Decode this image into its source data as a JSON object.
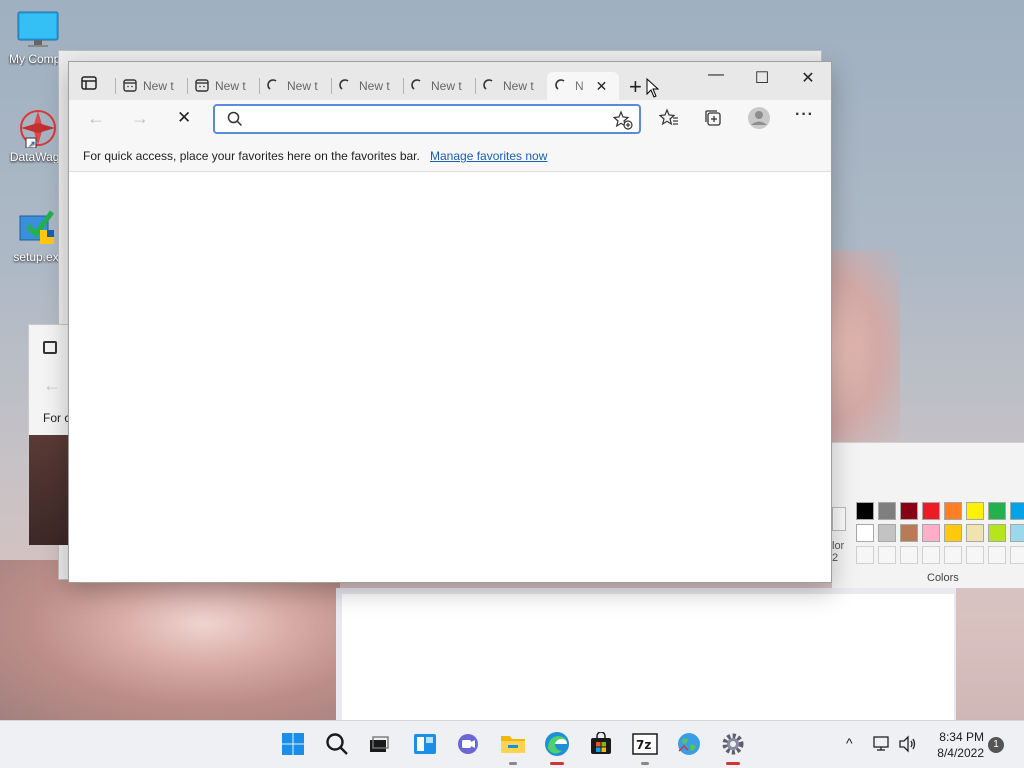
{
  "desktop": {
    "icons": [
      {
        "label": "My Compu"
      },
      {
        "label": "DataWago"
      },
      {
        "label": "setup.ex"
      }
    ]
  },
  "background_window": {
    "left_fragment": "For c"
  },
  "paint": {
    "colors_label": "Colors",
    "color_fragment_1": "lor",
    "color_fragment_2": "2",
    "palette_row1": [
      "#000000",
      "#7f7f7f",
      "#880015",
      "#ed1c24",
      "#ff7f27",
      "#fff200",
      "#22b14c",
      "#00a2e8"
    ],
    "palette_row2": [
      "#ffffff",
      "#c3c3c3",
      "#b97a57",
      "#ffaec9",
      "#ffc90e",
      "#efe4b0",
      "#b5e61d",
      "#99d9ea"
    ]
  },
  "browser": {
    "tabs": [
      {
        "label": "New t",
        "icon": "calendar-icon"
      },
      {
        "label": "New t",
        "icon": "calendar-icon"
      },
      {
        "label": "New t",
        "icon": "loading-icon"
      },
      {
        "label": "New t",
        "icon": "loading-icon"
      },
      {
        "label": "New t",
        "icon": "loading-icon"
      },
      {
        "label": "New t",
        "icon": "loading-icon"
      }
    ],
    "active_tab": {
      "label": "N",
      "close": "✕"
    },
    "newtab_glyph": "+",
    "window_controls": {
      "minimize": "—",
      "maximize": "☐",
      "close": "✕"
    },
    "nav": {
      "back": "←",
      "forward": "→",
      "stop": "✕"
    },
    "address": {
      "value": "",
      "placeholder": ""
    },
    "favorites_bar": {
      "message": "For quick access, place your favorites here on the favorites bar.",
      "link": "Manage favorites now"
    },
    "more_glyph": "···"
  },
  "taskbar": {
    "apps": [
      "start",
      "search",
      "task-view",
      "widgets",
      "chat",
      "file-explorer",
      "edge",
      "store",
      "7zip",
      "network-globe",
      "settings"
    ],
    "clock_time": "8:34 PM",
    "clock_date": "8/4/2022",
    "notification_count": "1",
    "tray_chevron": "^"
  }
}
